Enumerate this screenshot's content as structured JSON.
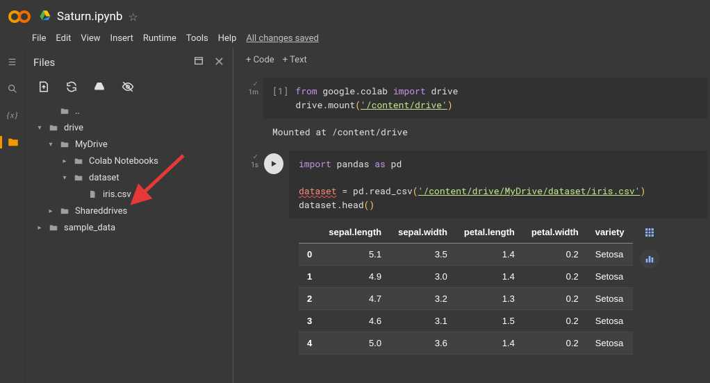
{
  "header": {
    "title": "Saturn.ipynb",
    "saved_status": "All changes saved"
  },
  "menu": {
    "file": "File",
    "edit": "Edit",
    "view": "View",
    "insert": "Insert",
    "runtime": "Runtime",
    "tools": "Tools",
    "help": "Help"
  },
  "files_panel": {
    "title": "Files",
    "tree": {
      "updir": "..",
      "drive": "drive",
      "mydrive": "MyDrive",
      "colab": "Colab Notebooks",
      "dataset": "dataset",
      "iriscsv": "iris.csv",
      "shared": "Shareddrives",
      "sample": "sample_data"
    }
  },
  "nb_toolbar": {
    "code": "+  Code",
    "text": "+  Text"
  },
  "cell1": {
    "time": "1m",
    "prompt": "[1]",
    "line1_from": "from",
    "line1_mod": " google.colab ",
    "line1_import": "import",
    "line1_target": " drive",
    "line2_pre": "drive.mount",
    "line2_str": "'/content/drive'",
    "output": "Mounted at /content/drive"
  },
  "cell2": {
    "time": "1s",
    "line1_import": "import",
    "line1_mod": " pandas ",
    "line1_as": "as",
    "line1_alias": " pd",
    "line3_var": "dataset",
    "line3_mid": " = pd.read_csv",
    "line3_str": "'/content/drive/MyDrive/dataset/iris.csv'",
    "line4": "dataset.head",
    "table": {
      "headers": [
        "",
        "sepal.length",
        "sepal.width",
        "petal.length",
        "petal.width",
        "variety"
      ],
      "rows": [
        [
          "0",
          "5.1",
          "3.5",
          "1.4",
          "0.2",
          "Setosa"
        ],
        [
          "1",
          "4.9",
          "3.0",
          "1.4",
          "0.2",
          "Setosa"
        ],
        [
          "2",
          "4.7",
          "3.2",
          "1.3",
          "0.2",
          "Setosa"
        ],
        [
          "3",
          "4.6",
          "3.1",
          "1.5",
          "0.2",
          "Setosa"
        ],
        [
          "4",
          "5.0",
          "3.6",
          "1.4",
          "0.2",
          "Setosa"
        ]
      ]
    }
  }
}
